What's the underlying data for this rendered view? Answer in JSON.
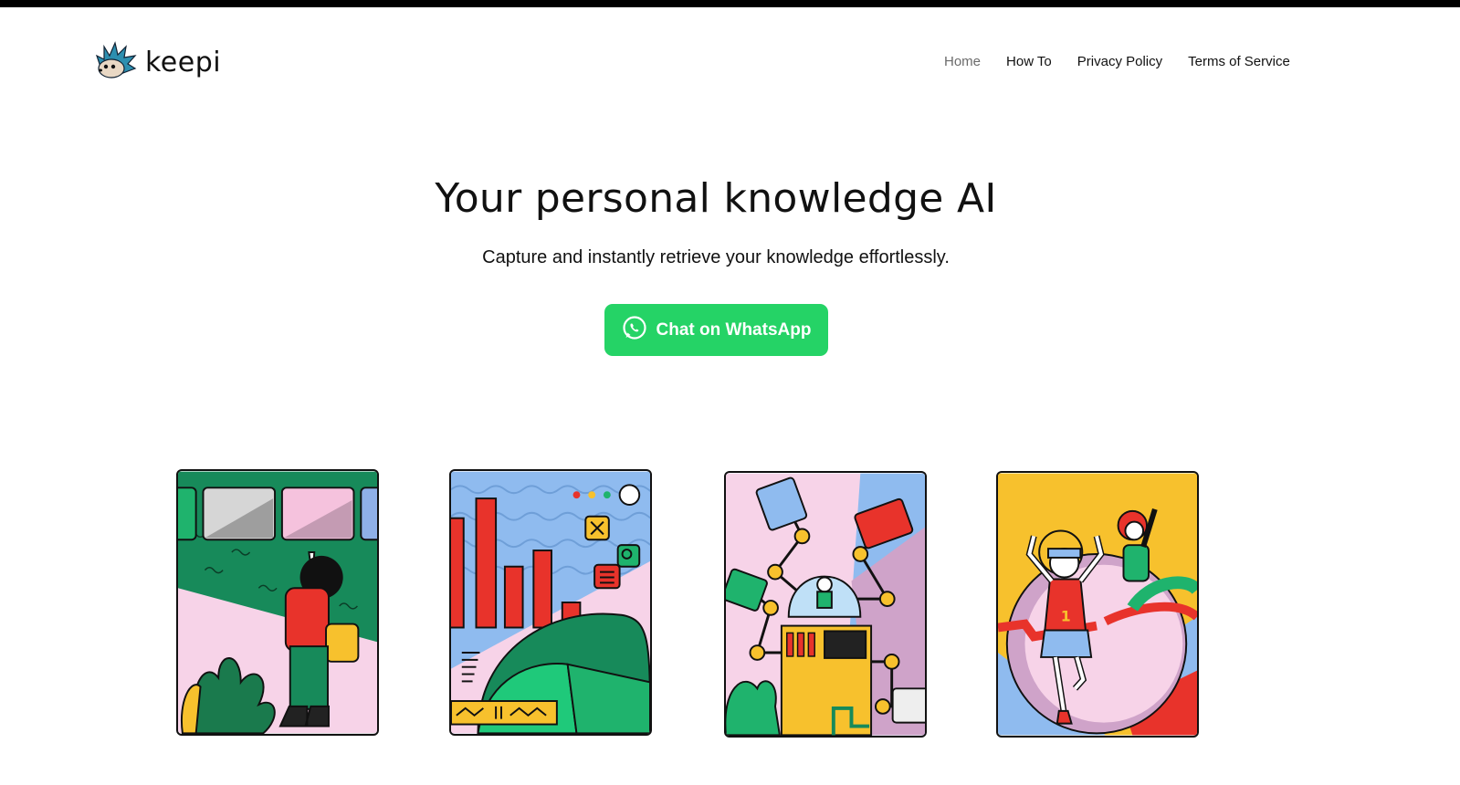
{
  "brand": {
    "name": "keepi",
    "logo_icon": "hedgehog-icon"
  },
  "nav": {
    "items": [
      {
        "label": "Home",
        "active": true
      },
      {
        "label": "How To",
        "active": false
      },
      {
        "label": "Privacy Policy",
        "active": false
      },
      {
        "label": "Terms of Service",
        "active": false
      }
    ]
  },
  "hero": {
    "title": "Your personal knowledge AI",
    "subtitle": "Capture and instantly retrieve your knowledge effortlessly.",
    "cta_label": "Chat on WhatsApp",
    "cta_icon": "whatsapp-icon"
  },
  "colors": {
    "whatsapp_green": "#25D366",
    "nav_active": "#6b6b6b",
    "topbar": "#000000"
  },
  "illustrations": [
    {
      "icon": "organizing-browser-windows-illustration"
    },
    {
      "icon": "data-charts-illustration"
    },
    {
      "icon": "robot-arms-automation-illustration"
    },
    {
      "icon": "finish-line-celebration-illustration"
    }
  ]
}
